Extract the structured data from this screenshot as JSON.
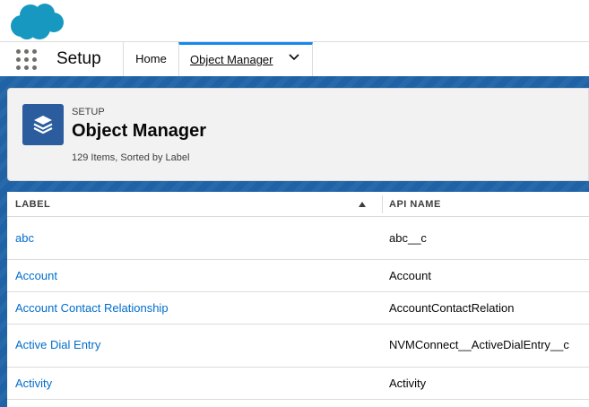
{
  "brand": {
    "logo_color": "#1798c1"
  },
  "nav": {
    "app_name": "Setup",
    "tabs": [
      {
        "label": "Home"
      },
      {
        "label": "Object Manager"
      }
    ]
  },
  "header": {
    "eyebrow": "SETUP",
    "title": "Object Manager",
    "subtitle": "129 Items, Sorted by Label",
    "icon": "layers-icon",
    "icon_color": "#2a5c9e"
  },
  "table": {
    "columns": [
      "LABEL",
      "API NAME"
    ],
    "sort_column": "LABEL",
    "rows": [
      {
        "label": "abc",
        "api": "abc__c"
      },
      {
        "label": "Account",
        "api": "Account"
      },
      {
        "label": "Account Contact Relationship",
        "api": "AccountContactRelation"
      },
      {
        "label": "Active Dial Entry",
        "api": "NVMConnect__ActiveDialEntry__c"
      },
      {
        "label": "Activity",
        "api": "Activity"
      }
    ]
  },
  "colors": {
    "band": "#1f63a6",
    "link": "#006dcc",
    "active_tab_accent": "#1589ee"
  }
}
